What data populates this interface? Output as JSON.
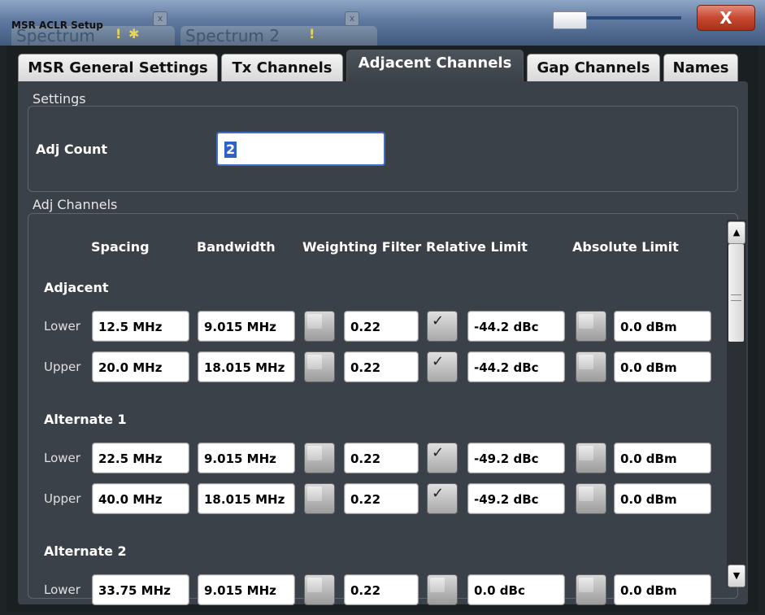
{
  "window": {
    "dialog_title": "MSR ACLR Setup",
    "bg_tabs": [
      "Spectrum",
      "Spectrum 2"
    ],
    "bg_tab_close": "x",
    "warning_glyph": "!",
    "close_label": "X"
  },
  "tabs": [
    {
      "label": "MSR General Settings"
    },
    {
      "label": "Tx Channels"
    },
    {
      "label": "Adjacent Channels",
      "active": true
    },
    {
      "label": "Gap Channels"
    },
    {
      "label": "Names"
    }
  ],
  "settings": {
    "section_label": "Settings",
    "adj_count_label": "Adj Count",
    "adj_count_value": "2"
  },
  "adj_channels": {
    "section_label": "Adj Channels",
    "columns": [
      "Spacing",
      "Bandwidth",
      "Weighting Filter",
      "Relative Limit",
      "Absolute Limit"
    ],
    "groups": [
      {
        "name": "Adjacent",
        "rows": [
          {
            "label": "Lower",
            "spacing": "12.5 MHz",
            "bandwidth": "9.015 MHz",
            "weight_on": false,
            "weight": "0.22",
            "rel_on": true,
            "rel": "-44.2 dBc",
            "abs_on": false,
            "abs": "0.0 dBm"
          },
          {
            "label": "Upper",
            "spacing": "20.0 MHz",
            "bandwidth": "18.015 MHz",
            "weight_on": false,
            "weight": "0.22",
            "rel_on": true,
            "rel": "-44.2 dBc",
            "abs_on": false,
            "abs": "0.0 dBm"
          }
        ]
      },
      {
        "name": "Alternate 1",
        "rows": [
          {
            "label": "Lower",
            "spacing": "22.5 MHz",
            "bandwidth": "9.015 MHz",
            "weight_on": false,
            "weight": "0.22",
            "rel_on": true,
            "rel": "-49.2 dBc",
            "abs_on": false,
            "abs": "0.0 dBm"
          },
          {
            "label": "Upper",
            "spacing": "40.0 MHz",
            "bandwidth": "18.015 MHz",
            "weight_on": false,
            "weight": "0.22",
            "rel_on": true,
            "rel": "-49.2 dBc",
            "abs_on": false,
            "abs": "0.0 dBm"
          }
        ]
      },
      {
        "name": "Alternate 2",
        "rows": [
          {
            "label": "Lower",
            "spacing": "33.75 MHz",
            "bandwidth": "9.015 MHz",
            "weight_on": false,
            "weight": "0.22",
            "rel_on": false,
            "rel": "0.0 dBc",
            "abs_on": false,
            "abs": "0.0 dBm"
          }
        ]
      }
    ]
  },
  "scrollbar": {
    "up_glyph": "▲",
    "down_glyph": "▼"
  },
  "colors": {
    "panel": "#3b4148",
    "tab_active": "#454c54",
    "close": "#c64831",
    "selection": "#2f62c8"
  }
}
